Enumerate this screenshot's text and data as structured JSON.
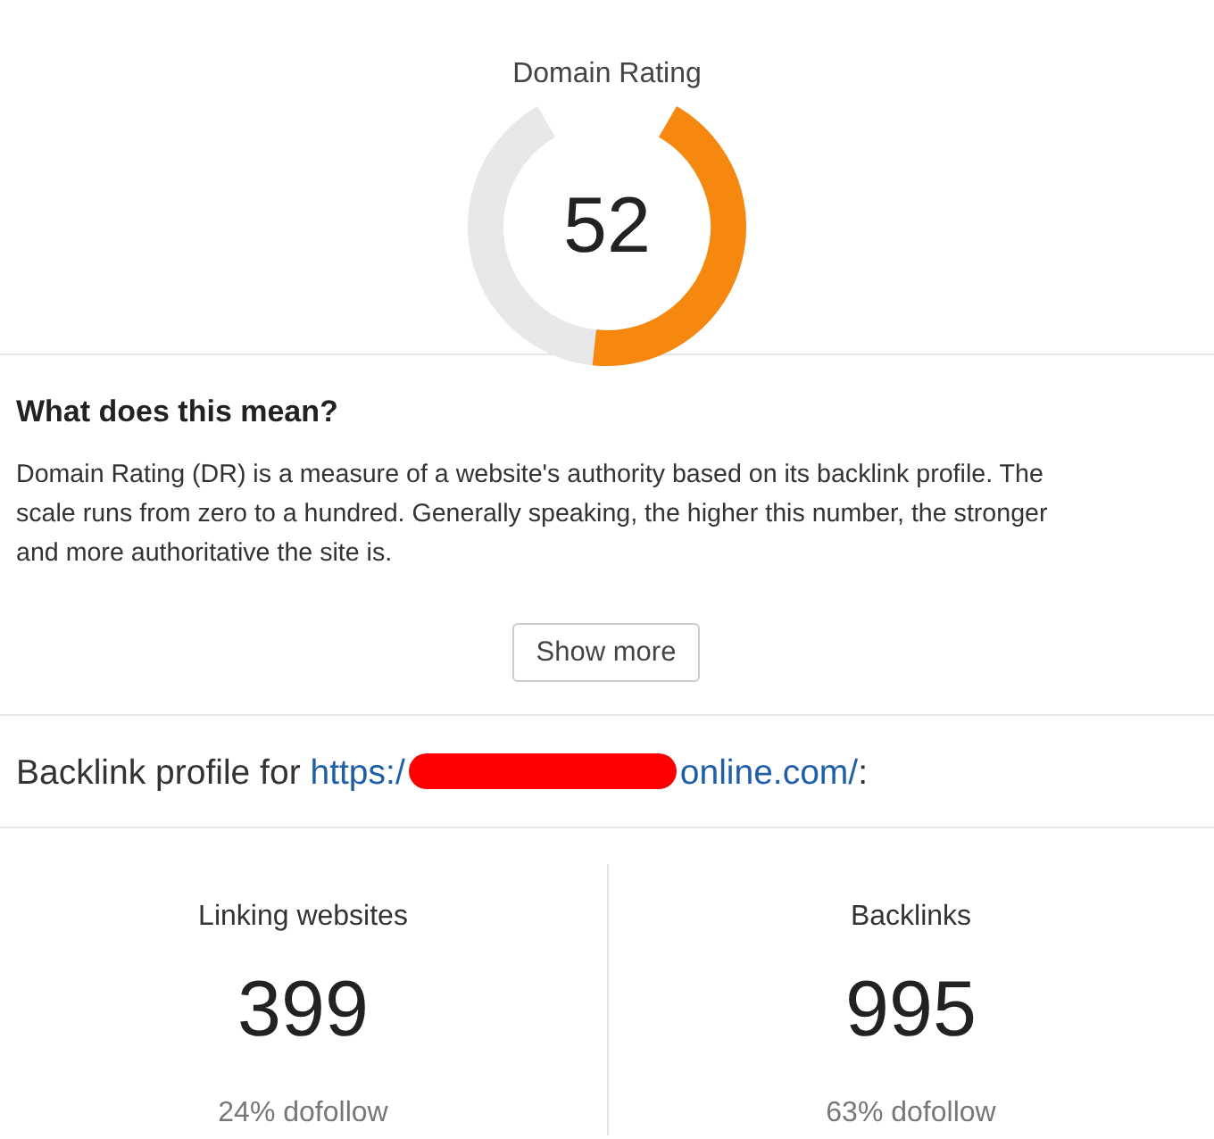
{
  "rating": {
    "title": "Domain Rating",
    "value": "52"
  },
  "explanation": {
    "heading": "What does this mean?",
    "lines": [
      "Domain Rating (DR) is a measure of a website's authority based on its backlink profile. The",
      "scale runs from zero to a hundred. Generally speaking, the higher this number, the stronger",
      "and more authoritative the site is."
    ],
    "button": "Show more"
  },
  "backlink_profile": {
    "heading": "Backlink profile for",
    "url_start": "https:/",
    "url_end": "online.com/",
    "suffix": ":"
  },
  "stats": [
    {
      "label": "Linking websites",
      "value": "399",
      "note": "24% dofollow"
    },
    {
      "label": "Backlinks",
      "value": "995",
      "note": "63% dofollow"
    }
  ]
}
